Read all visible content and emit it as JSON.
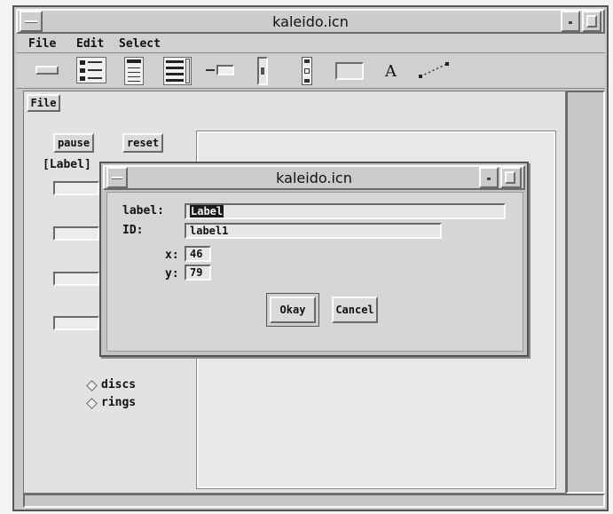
{
  "main_window": {
    "title": "kaleido.icn",
    "menu": [
      "File",
      "Edit",
      "Select"
    ],
    "palette_icons": [
      "button-tool-icon",
      "radio-list-tool-icon",
      "text-list-tool-icon",
      "scroll-list-tool-icon",
      "text-field-tool-icon",
      "vertical-slider-tool-icon",
      "scrollbar-tool-icon",
      "region-tool-icon",
      "text-tool-icon",
      "line-tool-icon"
    ],
    "palette_text_glyph": "A"
  },
  "canvas": {
    "menu_file": "File",
    "pause_label": "pause",
    "reset_label": "reset",
    "label_widget": "[Label]",
    "radio_options": [
      "discs",
      "rings"
    ]
  },
  "dialog": {
    "title": "kaleido.icn",
    "label_caption": "label:",
    "label_value": "Label",
    "id_caption": "ID:",
    "id_value": "label1",
    "x_caption": "x:",
    "x_value": "46",
    "y_caption": "y:",
    "y_value": "79",
    "okay_label": "Okay",
    "cancel_label": "Cancel"
  }
}
